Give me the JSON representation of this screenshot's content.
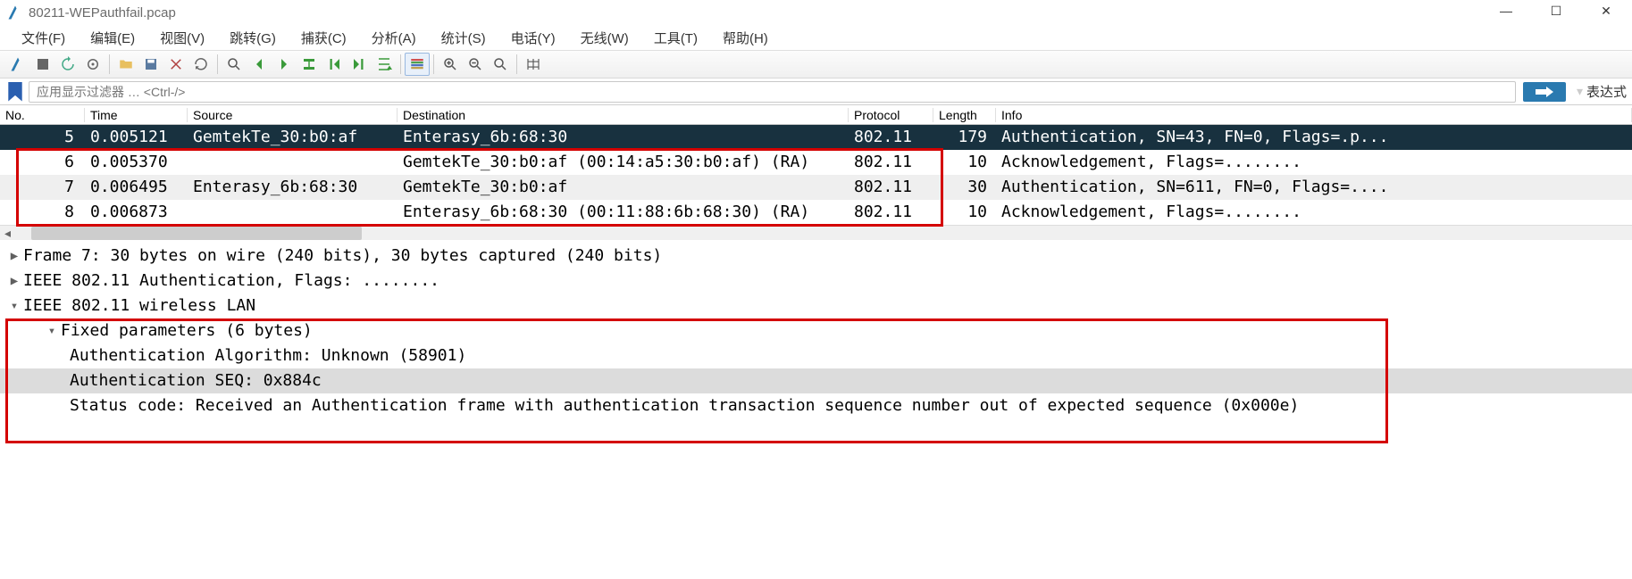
{
  "title": "80211-WEPauthfail.pcap",
  "menu": [
    "文件(F)",
    "编辑(E)",
    "视图(V)",
    "跳转(G)",
    "捕获(C)",
    "分析(A)",
    "统计(S)",
    "电话(Y)",
    "无线(W)",
    "工具(T)",
    "帮助(H)"
  ],
  "filter_placeholder": "应用显示过滤器 … <Ctrl-/>",
  "expr_label": "表达式",
  "columns": {
    "no": "No.",
    "time": "Time",
    "src": "Source",
    "dst": "Destination",
    "proto": "Protocol",
    "len": "Length",
    "info": "Info"
  },
  "packets": [
    {
      "no": "5",
      "time": "0.005121",
      "src": "GemtekTe_30:b0:af",
      "dst": "Enterasy_6b:68:30",
      "proto": "802.11",
      "len": "179",
      "info": "Authentication, SN=43, FN=0, Flags=.p...",
      "selected": true
    },
    {
      "no": "6",
      "time": "0.005370",
      "src": "",
      "dst": "GemtekTe_30:b0:af (00:14:a5:30:b0:af) (RA)",
      "proto": "802.11",
      "len": "10",
      "info": "Acknowledgement, Flags=........"
    },
    {
      "no": "7",
      "time": "0.006495",
      "src": "Enterasy_6b:68:30",
      "dst": "GemtekTe_30:b0:af",
      "proto": "802.11",
      "len": "30",
      "info": "Authentication, SN=611, FN=0, Flags=....",
      "alt": true
    },
    {
      "no": "8",
      "time": "0.006873",
      "src": "",
      "dst": "Enterasy_6b:68:30 (00:11:88:6b:68:30) (RA)",
      "proto": "802.11",
      "len": "10",
      "info": "Acknowledgement, Flags=........"
    }
  ],
  "details": {
    "frame": "Frame 7: 30 bytes on wire (240 bits), 30 bytes captured (240 bits)",
    "ieee_auth": "IEEE 802.11 Authentication, Flags: ........",
    "ieee_wlan": "IEEE 802.11 wireless LAN",
    "fixed_params": "Fixed parameters (6 bytes)",
    "auth_algo": "Authentication Algorithm: Unknown (58901)",
    "auth_seq": "Authentication SEQ: 0x884c",
    "status": "Status code: Received an Authentication frame with authentication transaction sequence number out of expected sequence (0x000e)"
  }
}
